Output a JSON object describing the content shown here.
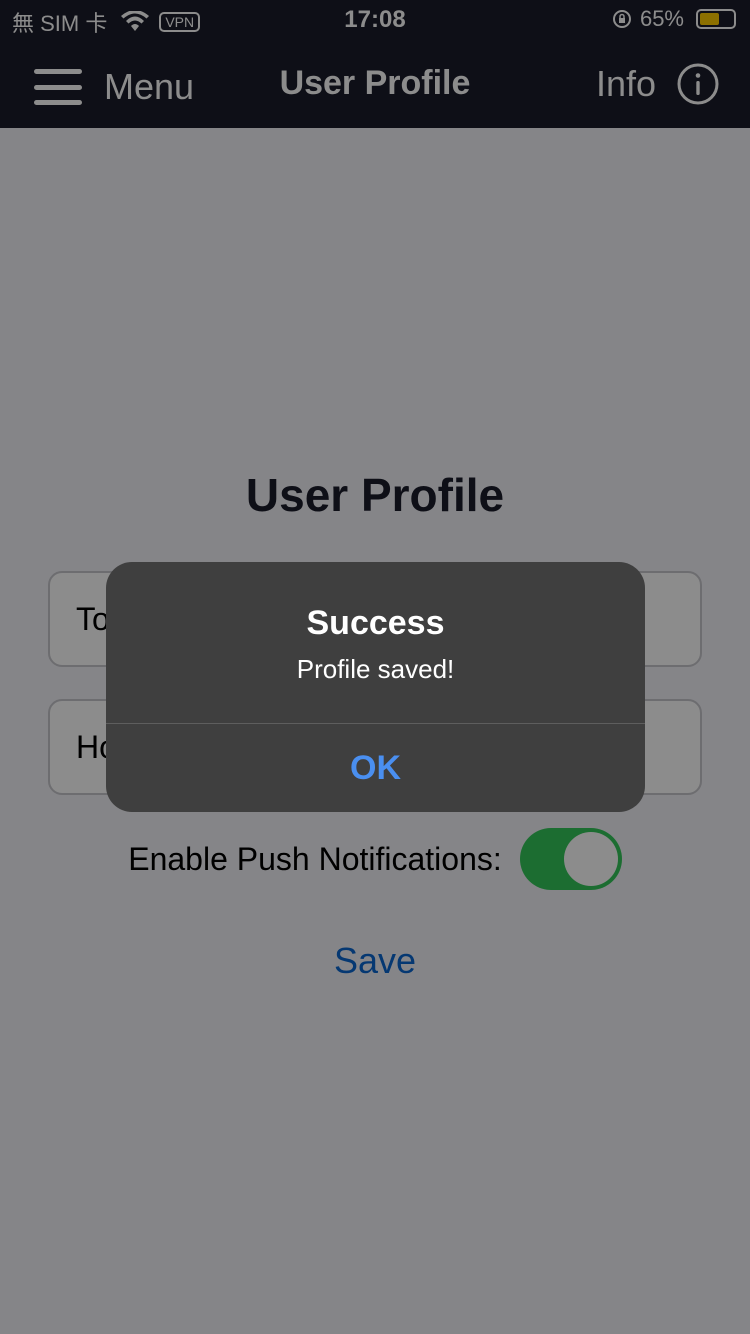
{
  "status_bar": {
    "carrier": "無 SIM 卡",
    "vpn": "VPN",
    "time": "17:08",
    "battery_percent": "65%",
    "battery_level": 0.65,
    "icons": [
      "wifi-icon",
      "orientation-lock-icon",
      "battery-icon"
    ]
  },
  "nav": {
    "menu_label": "Menu",
    "title": "User Profile",
    "info_label": "Info",
    "icons": [
      "hamburger-icon",
      "info-circle-icon"
    ]
  },
  "page": {
    "title": "User Profile",
    "field1_partial": "To",
    "field2_partial": "Ho",
    "push_label": "Enable Push Notifications:",
    "push_enabled": true,
    "save_label": "Save"
  },
  "alert": {
    "title": "Success",
    "message": "Profile saved!",
    "ok_label": "OK"
  },
  "colors": {
    "nav_bg": "#1b1c2a",
    "toggle_on": "#34c759",
    "link": "#0a66d0",
    "alert_button": "#4a8ff0",
    "battery": "#ffcc00"
  }
}
